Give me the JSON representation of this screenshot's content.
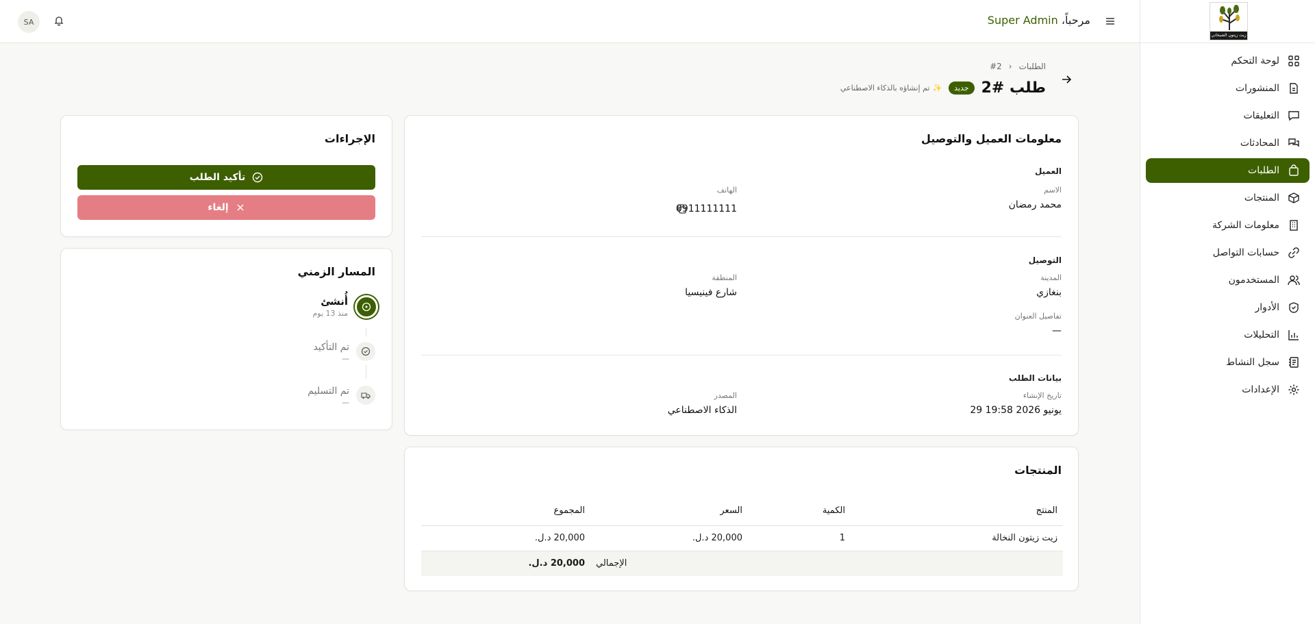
{
  "brand": {
    "logo_text": "زيت زيتون الشيخاني"
  },
  "topbar": {
    "avatar_initials": "SA",
    "welcome": "مرحباً،",
    "user_name": "Super Admin"
  },
  "sidebar": {
    "items": [
      {
        "label": "لوحة التحكم",
        "icon": "dashboard-icon"
      },
      {
        "label": "المنشورات",
        "icon": "file-icon"
      },
      {
        "label": "التعليقات",
        "icon": "comment-icon"
      },
      {
        "label": "المحادثات",
        "icon": "chat-icon"
      },
      {
        "label": "الطلبات",
        "icon": "bag-icon",
        "active": true
      },
      {
        "label": "المنتجات",
        "icon": "box-icon"
      },
      {
        "label": "معلومات الشركة",
        "icon": "building-icon"
      },
      {
        "label": "حسابات التواصل",
        "icon": "link-icon"
      },
      {
        "label": "المستخدمون",
        "icon": "users-icon"
      },
      {
        "label": "الأدوار",
        "icon": "shield-icon"
      },
      {
        "label": "التحليلات",
        "icon": "chart-icon"
      },
      {
        "label": "سجل النشاط",
        "icon": "log-icon"
      },
      {
        "label": "الإعدادات",
        "icon": "gear-icon"
      }
    ]
  },
  "header": {
    "breadcrumb_parent": "الطلبات",
    "breadcrumb_current": "#2",
    "title": "طلب #2",
    "badge": "جديد",
    "ai_note": "تم إنشاؤه بالذكاء الاصطناعي"
  },
  "customer_card": {
    "title": "معلومات العميل والتوصيل",
    "customer_section": "العميل",
    "name_label": "الاسم",
    "name_value": "محمد رمضان",
    "phone_label": "الهاتف",
    "phone_value": "0911111111",
    "delivery_section": "التوصيل",
    "city_label": "المدينة",
    "city_value": "بنغازي",
    "area_label": "المنطقة",
    "area_value": "شارع فينيسيا",
    "address_label": "تفاصيل العنوان",
    "address_value": "—",
    "order_section": "بيانات الطلب",
    "created_label": "تاريخ الإنشاء",
    "created_value": "29 يونيو 2026 19:58",
    "source_label": "المصدر",
    "source_value": "الذكاء الاصطناعي"
  },
  "products_card": {
    "title": "المنتجات",
    "columns": [
      "المنتج",
      "الكمية",
      "السعر",
      "المجموع"
    ],
    "rows": [
      {
        "product": "زيت زيتون النخالة",
        "qty": "1",
        "price": "20,000 د.ل.",
        "total": "20,000 د.ل."
      }
    ],
    "total_label": "الإجمالي",
    "total_value": "20,000 د.ل."
  },
  "actions_card": {
    "title": "الإجراءات",
    "confirm_label": "تأكيد الطلب",
    "cancel_label": "إلغاء"
  },
  "timeline_card": {
    "title": "المسار الزمني",
    "steps": [
      {
        "name": "أُنشئ",
        "sub": "منذ 13 يوم",
        "active": true
      },
      {
        "name": "تم التأكيد",
        "sub": "—"
      },
      {
        "name": "تم التسليم",
        "sub": "—"
      }
    ]
  },
  "colors": {
    "primary": "#3d5f00",
    "cancel": "#e57e84",
    "background": "#f8f8f6"
  }
}
